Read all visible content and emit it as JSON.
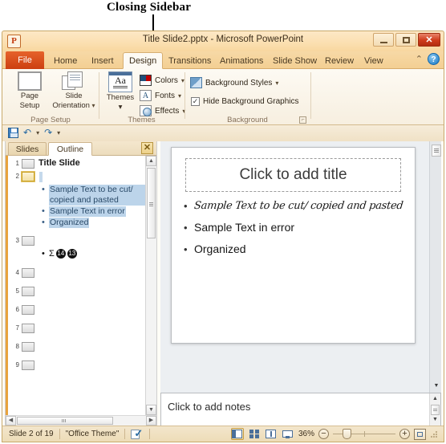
{
  "annotation": {
    "label": "Closing Sidebar"
  },
  "window": {
    "title": "Title Slide2.pptx  -  Microsoft PowerPoint",
    "app_icon": "powerpoint-icon",
    "buttons": {
      "minimize": "minimize-icon",
      "maximize": "maximize-icon",
      "close": "✕"
    }
  },
  "ribbon": {
    "tabs": [
      {
        "label": "File",
        "active": false
      },
      {
        "label": "Home",
        "active": false
      },
      {
        "label": "Insert",
        "active": false
      },
      {
        "label": "Design",
        "active": true
      },
      {
        "label": "Transitions",
        "active": false
      },
      {
        "label": "Animations",
        "active": false
      },
      {
        "label": "Slide Show",
        "active": false
      },
      {
        "label": "Review",
        "active": false
      },
      {
        "label": "View",
        "active": false
      }
    ],
    "minimize_ribbon": "⌃",
    "help": "?",
    "groups": {
      "page_setup": {
        "label": "Page Setup",
        "page_setup_button": "Page\nSetup",
        "page_setup_line1": "Page",
        "page_setup_line2": "Setup",
        "slide_orientation_line1": "Slide",
        "slide_orientation_line2": "Orientation"
      },
      "themes": {
        "label": "Themes",
        "themes_button": "Themes",
        "themes_glyph": "Aa",
        "colors": "Colors",
        "fonts": "Fonts",
        "effects": "Effects",
        "fonts_glyph": "A"
      },
      "background": {
        "label": "Background",
        "background_styles": "Background Styles",
        "hide_background_graphics": "Hide Background Graphics",
        "hide_checked": "✓",
        "launcher": "⌐"
      }
    }
  },
  "quick_access": {
    "save": "save-icon",
    "undo": "↶",
    "undo_caret": "▾",
    "redo": "↷",
    "customize": "▾"
  },
  "outline_pane": {
    "tabs": [
      {
        "label": "Slides",
        "active": false
      },
      {
        "label": "Outline",
        "active": true
      }
    ],
    "close_button": "✕",
    "slides": [
      {
        "number": "1",
        "title": "Title Slide",
        "selected": false
      },
      {
        "number": "2",
        "title": "",
        "selected": true
      },
      {
        "number": "3",
        "title": "",
        "selected": false
      },
      {
        "number": "4",
        "title": "",
        "selected": false
      },
      {
        "number": "5",
        "title": "",
        "selected": false
      },
      {
        "number": "6",
        "title": "",
        "selected": false
      },
      {
        "number": "7",
        "title": "",
        "selected": false
      },
      {
        "number": "8",
        "title": "",
        "selected": false
      },
      {
        "number": "9",
        "title": "",
        "selected": false
      }
    ],
    "bullets": [
      "Sample Text to be cut/ copied and pasted",
      "Sample Text in error",
      "Organized"
    ],
    "slide3_symbols": {
      "sigma": "Σ",
      "num1": "14",
      "num2": "13"
    },
    "bullet_dot": "•",
    "scroll_up": "▲",
    "scroll_down": "▼",
    "scroll_left": "◀",
    "scroll_right": "▶"
  },
  "slide": {
    "title_placeholder": "Click to add title",
    "bullets": [
      {
        "text": "Sample Text to be cut/ copied and pasted",
        "style": "script"
      },
      {
        "text": "Sample Text in error",
        "style": "normal"
      },
      {
        "text": "Organized",
        "style": "normal"
      }
    ],
    "bullet_dot": "•",
    "prev_slide": "▲",
    "next_slide": "▼",
    "double_arrow": "▲"
  },
  "notes": {
    "placeholder": "Click to add notes",
    "scroll_up": "▲",
    "scroll_down": "▼"
  },
  "status_bar": {
    "slide_count": "Slide 2 of 19",
    "theme": "\"Office Theme\"",
    "spell_check": "spell-check-icon",
    "views": [
      {
        "name": "normal",
        "active": true
      },
      {
        "name": "slide-sorter",
        "active": false
      },
      {
        "name": "reading-view",
        "active": false
      },
      {
        "name": "slide-show",
        "active": false
      }
    ],
    "zoom_level": "36%",
    "zoom_out": "−",
    "zoom_in": "+",
    "fit_to_window": "fit-window-icon"
  },
  "colors": {
    "accent_orange": "#e6622b",
    "frame_tan": "#f6d9a8",
    "selection_blue": "#bcd4ea",
    "outline_text_blue": "#2a4a68",
    "close_red": "#cf3b1b"
  }
}
